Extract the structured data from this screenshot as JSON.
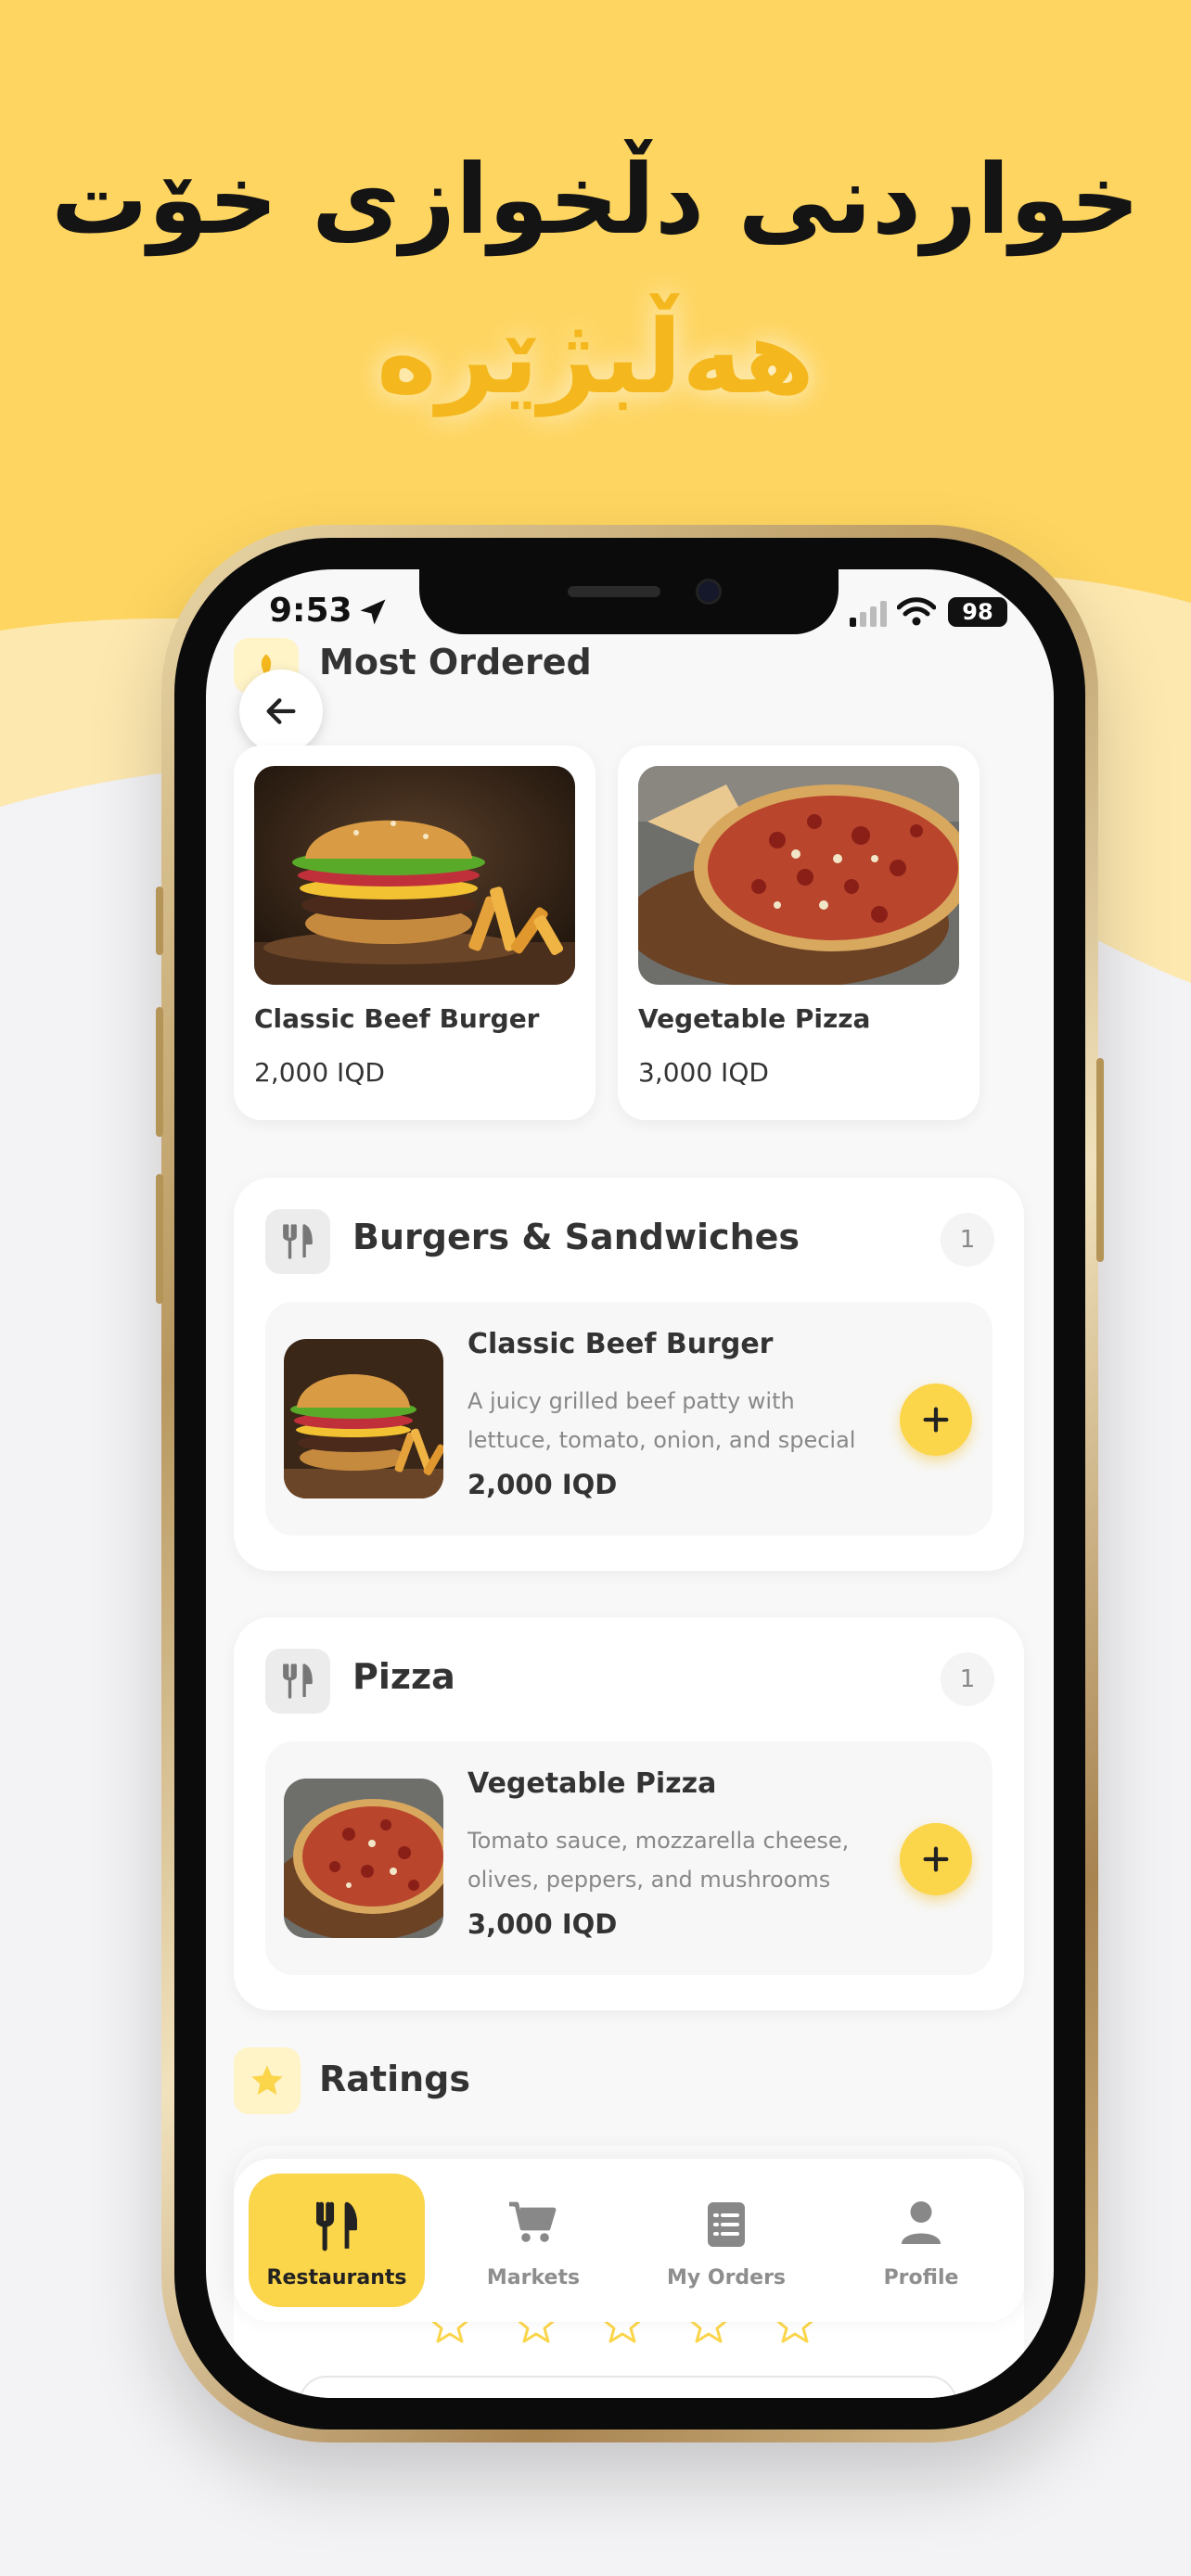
{
  "promo": {
    "headline": "خواردنی دڵخوازی خۆت",
    "subheadline": "هەڵبژێرە"
  },
  "status_bar": {
    "time": "9:53",
    "battery": "98"
  },
  "most_ordered": {
    "title": "Most Ordered",
    "items": [
      {
        "name": "Classic Beef Burger",
        "price": "2,000 IQD"
      },
      {
        "name": "Vegetable Pizza",
        "price": "3,000 IQD"
      }
    ]
  },
  "categories": [
    {
      "title": "Burgers & Sandwiches",
      "count": "1",
      "item": {
        "name": "Classic Beef Burger",
        "description": "A juicy grilled beef patty with lettuce, tomato, onion, and special sauce in a…",
        "price": "2,000 IQD"
      }
    },
    {
      "title": "Pizza",
      "count": "1",
      "item": {
        "name": "Vegetable Pizza",
        "description": " Tomato sauce, mozzarella cheese, olives, peppers, and mushrooms",
        "price": "3,000 IQD"
      }
    }
  ],
  "ratings": {
    "title": "Ratings"
  },
  "nav": {
    "items": [
      {
        "label": "Restaurants",
        "icon": "fork-knife-icon",
        "active": true
      },
      {
        "label": "Markets",
        "icon": "cart-icon",
        "active": false
      },
      {
        "label": "My Orders",
        "icon": "orders-icon",
        "active": false
      },
      {
        "label": "Profile",
        "icon": "person-icon",
        "active": false
      }
    ]
  },
  "colors": {
    "accent": "#fbd54a",
    "promo_bg": "#fed560",
    "subheadline": "#f4b81e"
  }
}
